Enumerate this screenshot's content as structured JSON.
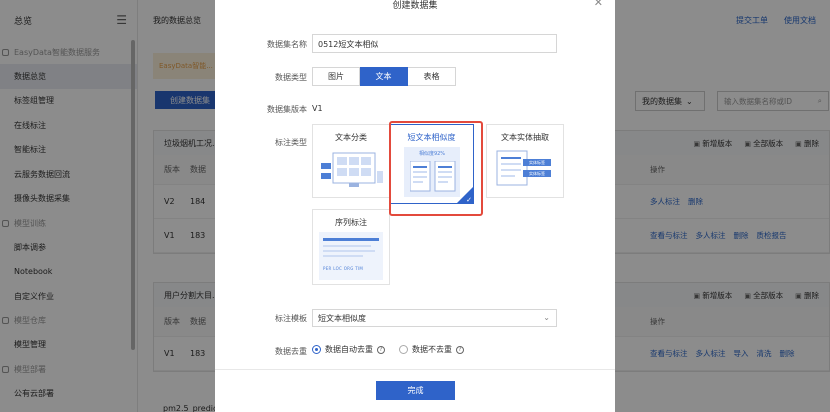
{
  "sidebar": {
    "title": "总览",
    "sections": [
      {
        "group": "EasyData智能数据服务",
        "items": [
          "数据总览",
          "标签组管理",
          "在线标注",
          "智能标注",
          "云服务数据回流",
          "摄像头数据采集"
        ]
      },
      {
        "group": "模型训练",
        "items": [
          "脚本调参",
          "Notebook",
          "自定义作业"
        ]
      },
      {
        "group": "模型仓库",
        "items": [
          "模型管理"
        ]
      },
      {
        "group": "模型部署",
        "items": [
          "公有云部署"
        ]
      }
    ]
  },
  "main": {
    "page_title": "我的数据总览",
    "top_links": [
      "提交工单",
      "使用文档"
    ],
    "notice": "EasyData智能...",
    "create_button": "创建数据集",
    "filter_select": "我的数据集",
    "search_placeholder": "输入数据集名称或ID",
    "cards": [
      {
        "title": "垃圾烟机工况...",
        "actions": [
          "新增版本",
          "全部版本",
          "删除"
        ],
        "header": [
          "版本",
          "数据",
          "操作"
        ],
        "rows": [
          {
            "version": "V2",
            "id": "184",
            "ops": [
              "多人标注",
              "删除"
            ]
          },
          {
            "version": "V1",
            "id": "183",
            "ops": [
              "查看与标注",
              "多人标注",
              "删除",
              "质检报告"
            ]
          }
        ]
      },
      {
        "title": "用户分割大目...",
        "actions": [
          "新增版本",
          "全部版本",
          "删除"
        ],
        "header": [
          "版本",
          "数据",
          "操作"
        ],
        "rows": [
          {
            "version": "V1",
            "id": "183",
            "ops": [
              "查看与标注",
              "多人标注",
              "导入",
              "清洗",
              "删除"
            ]
          }
        ]
      }
    ],
    "last_card_title": "pm2.5_predic"
  },
  "modal": {
    "title": "创建数据集",
    "fields": {
      "name_label": "数据集名称",
      "name_value": "0512短文本相似",
      "type_label": "数据类型",
      "types": [
        "图片",
        "文本",
        "表格"
      ],
      "selected_type": "文本",
      "version_label": "数据集版本",
      "version_value": "V1",
      "annotation_label": "标注类型",
      "annotation_types": [
        "文本分类",
        "短文本相似度",
        "文本实体抽取",
        "序列标注"
      ],
      "selected_annotation": "短文本相似度",
      "template_label": "标注模板",
      "template_value": "短文本相似度",
      "dedupe_label": "数据去重",
      "dedupe_options": [
        "数据自动去重",
        "数据不去重"
      ],
      "selected_dedupe": "数据自动去重"
    },
    "preview_text": {
      "similarity": "相似度92%",
      "entity_tags": [
        "实体标签",
        "实体标签"
      ],
      "sequence_tags": "PER LOC ORG TIM"
    },
    "done_button": "完成"
  },
  "colors": {
    "primary": "#2f63c9",
    "highlight": "#e34a3c",
    "mask": "rgba(0,0,0,0.45)"
  }
}
